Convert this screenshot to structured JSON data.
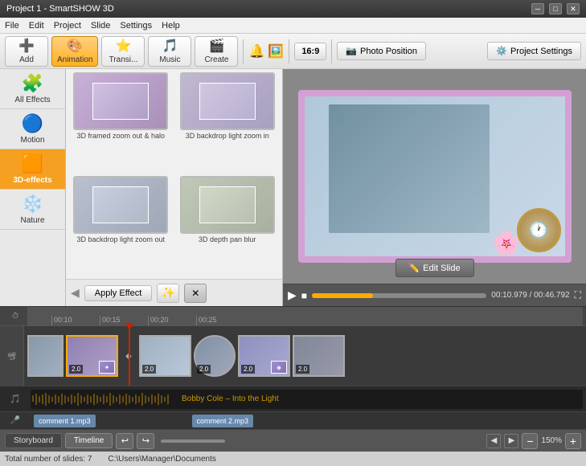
{
  "titleBar": {
    "title": "Project 1 - SmartSHOW 3D",
    "minimize": "─",
    "maximize": "□",
    "close": "✕"
  },
  "menuBar": {
    "items": [
      "File",
      "Edit",
      "Project",
      "Slide",
      "Settings",
      "Help"
    ]
  },
  "toolbar": {
    "add_label": "Add",
    "animation_label": "Animation",
    "transitions_label": "Transi...",
    "music_label": "Music",
    "create_label": "Create",
    "ratio_label": "16:9",
    "photo_position_label": "Photo Position",
    "project_settings_label": "Project Settings"
  },
  "leftPanel": {
    "categories": [
      {
        "id": "all-effects",
        "label": "All Effects",
        "icon": "🧩"
      },
      {
        "id": "motion",
        "label": "Motion",
        "icon": "🔵"
      },
      {
        "id": "3d-effects",
        "label": "3D-effects",
        "icon": "🟧",
        "active": true
      },
      {
        "id": "nature",
        "label": "Nature",
        "icon": "❄️"
      }
    ]
  },
  "effectsPanel": {
    "effects": [
      {
        "label": "3D framed zoom out & halo"
      },
      {
        "label": "3D backdrop light zoom in"
      },
      {
        "label": "3D backdrop light zoom out"
      },
      {
        "label": "3D depth pan blur"
      }
    ],
    "applyButton": "Apply Effect",
    "scrollbar": true
  },
  "preview": {
    "editSlideButton": "Edit Slide",
    "timeCode": "00:10.979 / 00:46.792"
  },
  "timeline": {
    "markers": [
      "00:10",
      "00:15",
      "00:20",
      "00:25"
    ],
    "slides": [
      {
        "num": "",
        "active": false
      },
      {
        "num": "2.0",
        "active": true
      },
      {
        "num": "2.0",
        "active": false
      },
      {
        "num": "2.0",
        "active": false
      },
      {
        "num": "2.0",
        "active": false
      }
    ],
    "audioTrack": {
      "label": "Bobby Cole – Into the Light"
    },
    "commentTracks": [
      {
        "label": "comment 1.mp3",
        "width": 180
      },
      {
        "label": "comment 2.mp3",
        "width": 180
      }
    ]
  },
  "bottomBar": {
    "storyboard": "Storyboard",
    "timeline": "Timeline",
    "zoom": "150%"
  },
  "statusBar": {
    "slides": "Total number of slides: 7",
    "path": "C:\\Users\\Manager\\Documents"
  }
}
